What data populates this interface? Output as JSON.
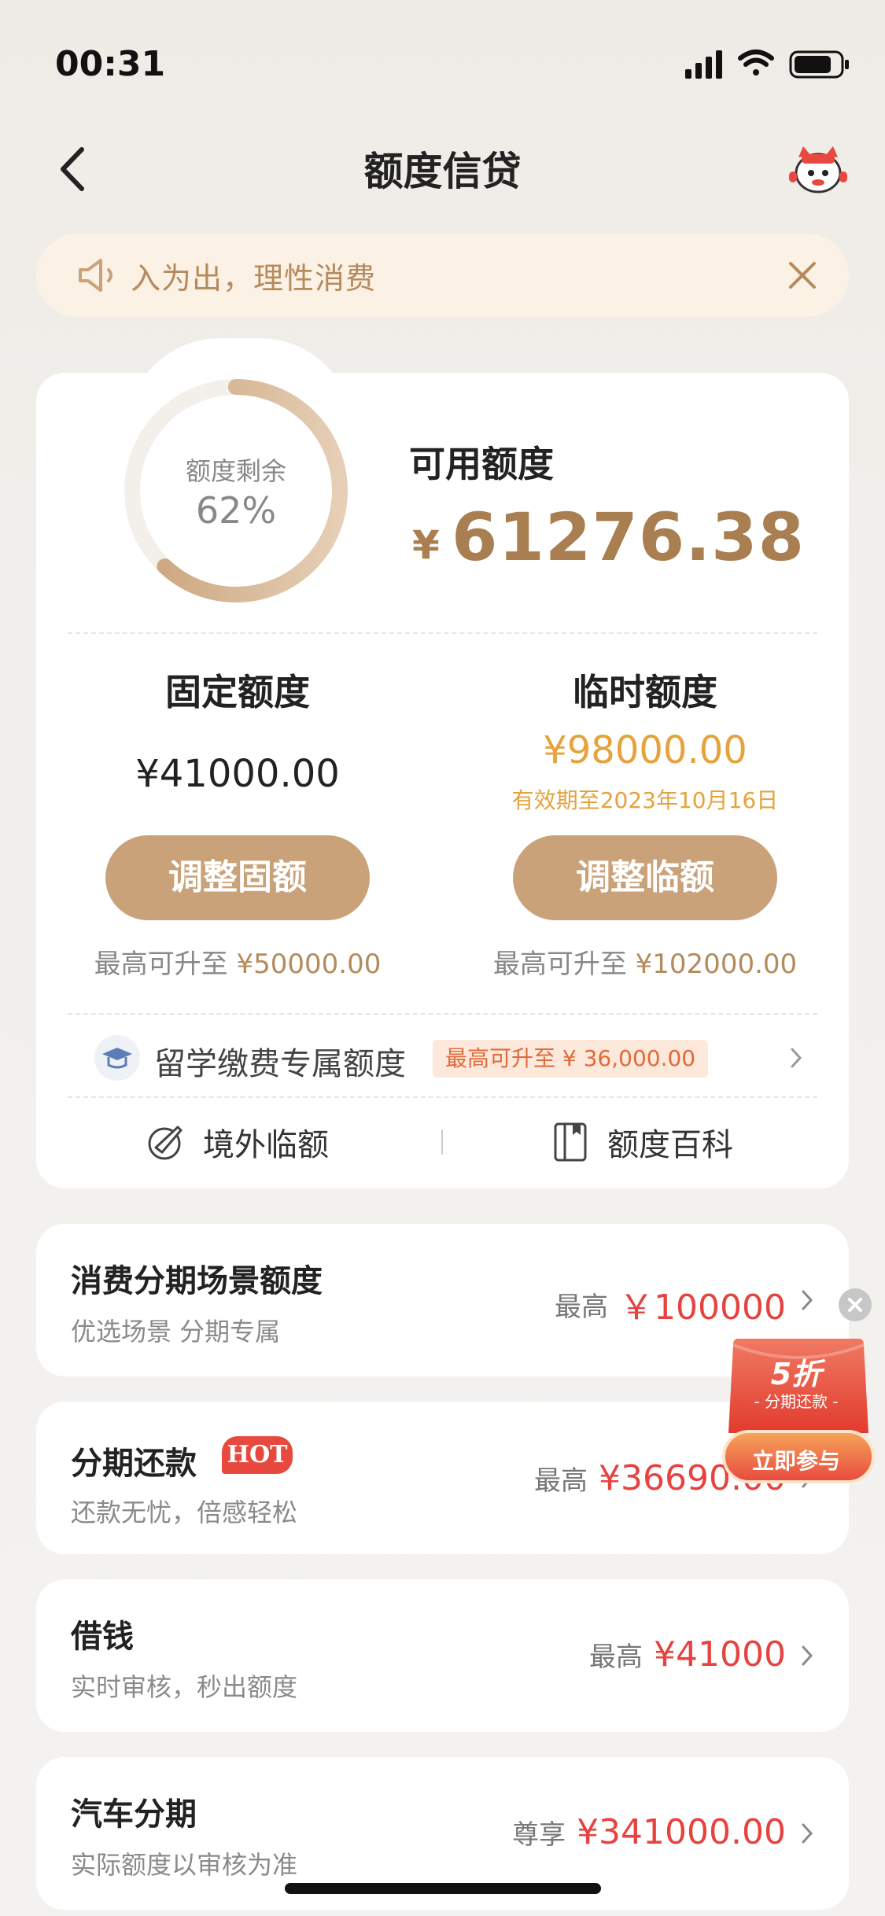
{
  "status_bar": {
    "time": "00:31"
  },
  "header": {
    "title": "额度信贷"
  },
  "notice": {
    "text": "入为出，理性消费"
  },
  "credit_card": {
    "ring_label": "额度剩余",
    "ring_percent": "62%",
    "ring_fraction": 0.62,
    "available_label": "可用额度",
    "currency": "¥",
    "available_amount": "61276.38",
    "fixed": {
      "title": "固定额度",
      "amount": "¥41000.00",
      "button": "调整固额",
      "max_prefix": "最高可升至",
      "max_value": "¥50000.00"
    },
    "temporary": {
      "title": "临时额度",
      "amount": "¥98000.00",
      "valid_until": "有效期至2023年10月16日",
      "button": "调整临额",
      "max_prefix": "最高可升至",
      "max_value": "¥102000.00"
    },
    "study": {
      "label": "留学缴费专属额度",
      "tag": "最高可升至 ¥ 36,000.00"
    },
    "links": {
      "overseas": "境外临额",
      "encyclopedia": "额度百科"
    }
  },
  "list": [
    {
      "title": "消费分期场景额度",
      "subtitle": "优选场景 分期专属",
      "prefix": "最高",
      "amount": "￥100000"
    },
    {
      "title": "分期还款",
      "badge": "HOT",
      "subtitle": "还款无忧，倍感轻松",
      "prefix": "最高",
      "amount": "¥36690.00"
    },
    {
      "title": "借钱",
      "subtitle": "实时审核，秒出额度",
      "prefix": "最高",
      "amount": "¥41000"
    },
    {
      "title": "汽车分期",
      "subtitle": "实际额度以审核为准",
      "prefix": "尊享",
      "amount": "¥341000.00"
    }
  ],
  "promo": {
    "discount": "5折",
    "subtitle": "- 分期还款 -",
    "button": "立即参与"
  },
  "colors": {
    "gold": "#a97e50",
    "button": "#c9a27a",
    "orange": "#e6a23c",
    "red": "#e64340"
  }
}
